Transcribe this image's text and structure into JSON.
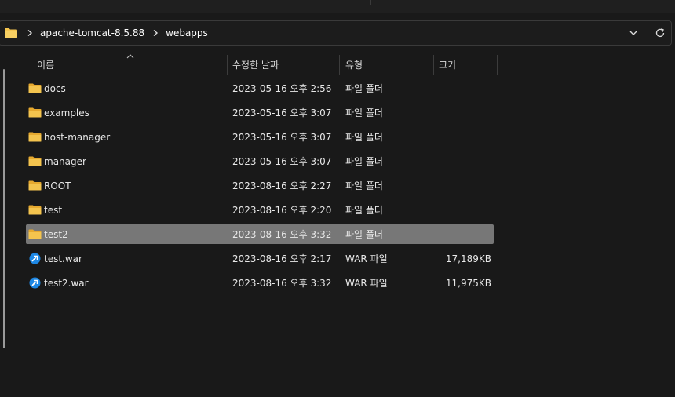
{
  "breadcrumb": {
    "items": [
      "apache-tomcat-8.5.88",
      "webapps"
    ]
  },
  "columns": {
    "name": "이름",
    "date": "수정한 날짜",
    "type": "유형",
    "size": "크기"
  },
  "files": [
    {
      "name": "docs",
      "date": "2023-05-16 오후 2:56",
      "type": "파일 폴더",
      "size": "",
      "icon": "folder-icon"
    },
    {
      "name": "examples",
      "date": "2023-05-16 오후 3:07",
      "type": "파일 폴더",
      "size": "",
      "icon": "folder-icon"
    },
    {
      "name": "host-manager",
      "date": "2023-05-16 오후 3:07",
      "type": "파일 폴더",
      "size": "",
      "icon": "folder-icon"
    },
    {
      "name": "manager",
      "date": "2023-05-16 오후 3:07",
      "type": "파일 폴더",
      "size": "",
      "icon": "folder-icon"
    },
    {
      "name": "ROOT",
      "date": "2023-08-16 오후 2:27",
      "type": "파일 폴더",
      "size": "",
      "icon": "folder-icon"
    },
    {
      "name": "test",
      "date": "2023-08-16 오후 2:20",
      "type": "파일 폴더",
      "size": "",
      "icon": "folder-icon"
    },
    {
      "name": "test2",
      "date": "2023-08-16 오후 3:32",
      "type": "파일 폴더",
      "size": "",
      "icon": "folder-icon",
      "selected": true
    },
    {
      "name": "test.war",
      "date": "2023-08-16 오후 2:17",
      "type": "WAR 파일",
      "size": "17,189KB",
      "icon": "war-file-icon"
    },
    {
      "name": "test2.war",
      "date": "2023-08-16 오후 3:32",
      "type": "WAR 파일",
      "size": "11,975KB",
      "icon": "war-file-icon"
    }
  ],
  "colors": {
    "background": "#191919",
    "selected_row": "#777777",
    "folder": "#f4c44e",
    "war_icon": "#1e88e5"
  }
}
